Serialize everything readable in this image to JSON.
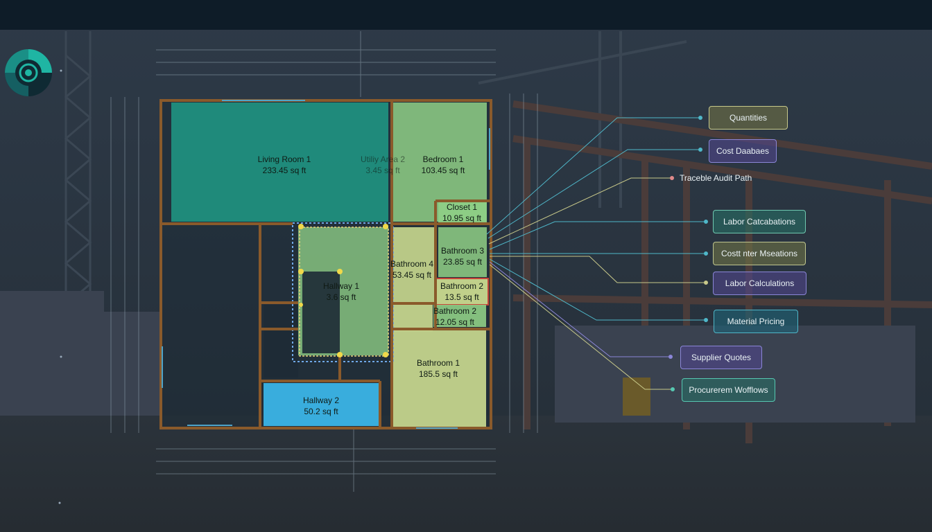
{
  "rooms": [
    {
      "key": "living_room_1",
      "name": "Living Room 1",
      "area": "233.45 sq ft"
    },
    {
      "key": "utility_area_2",
      "name": "Utiliy Area 2",
      "area": "3.45 sq ft"
    },
    {
      "key": "bedroom_1",
      "name": "Bedroom 1",
      "area": "103.45 sq ft"
    },
    {
      "key": "closet_1",
      "name": "Closet 1",
      "area": "10.95 sq ft"
    },
    {
      "key": "bathroom_3",
      "name": "Bathroom 3",
      "area": "23.85 sq ft"
    },
    {
      "key": "bathroom_4",
      "name": "Bathroom 4",
      "area": "53.45 sq ft"
    },
    {
      "key": "bathroom_2a",
      "name": "Bathroom 2",
      "area": "13.5 sq ft"
    },
    {
      "key": "bathroom_2b",
      "name": "Bathroom 2",
      "area": "12.05 sq ft"
    },
    {
      "key": "hallway_1",
      "name": "Hallway 1",
      "area": "3.6 sq ft"
    },
    {
      "key": "bathroom_1",
      "name": "Bathroom 1",
      "area": "185.5 sq ft"
    },
    {
      "key": "hallway_2",
      "name": "Hallway 2",
      "area": "50.2 sq ft"
    }
  ],
  "callouts": [
    {
      "key": "quantities",
      "label": "Quantities",
      "color": "#c8c98a"
    },
    {
      "key": "cost_databases",
      "label": "Cost Daabaes",
      "color": "#8b86d8"
    },
    {
      "key": "audit_path",
      "label": "Traceble Audit Path",
      "color": "#e08a8a"
    },
    {
      "key": "labor_calculations_1",
      "label": "Labor Catcabations",
      "color": "#6fc9b0"
    },
    {
      "key": "cost_measurements",
      "label": "Costt nter Mseations",
      "color": "#bfc68e"
    },
    {
      "key": "labor_calculations_2",
      "label": "Labor Calculations",
      "color": "#8b86d8"
    },
    {
      "key": "material_pricing",
      "label": "Material Pricing",
      "color": "#4fb7c9"
    },
    {
      "key": "supplier_quotes",
      "label": "Supplier Quotes",
      "color": "#8b86d8"
    },
    {
      "key": "procurement_workflows",
      "label": "Procurerem Wofflows",
      "color": "#56c9b2"
    }
  ],
  "colors": {
    "living_fill": "#1f9a86",
    "green_fill": "#8fcf86",
    "yellow_fill": "#c9d98f",
    "blue_fill": "#3bb4e6",
    "wall": "#8a5a2b",
    "accent_red": "#d0483a",
    "logo_teal": "#1fb5a3"
  }
}
